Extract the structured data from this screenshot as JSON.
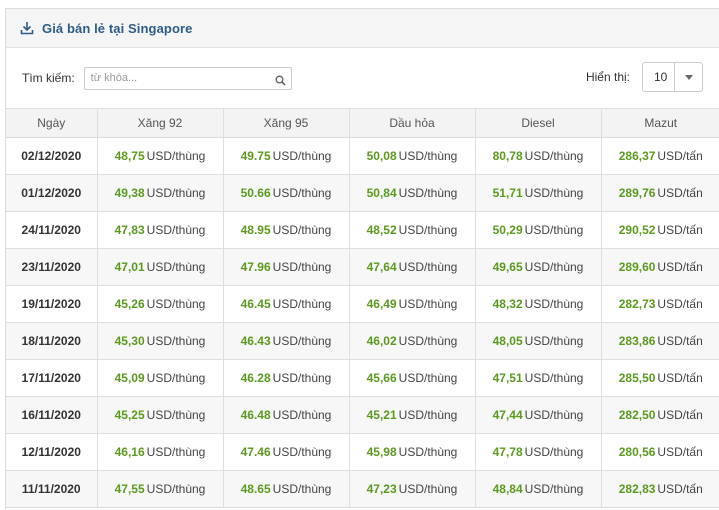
{
  "panel": {
    "title": "Giá bán lẻ tại Singapore"
  },
  "toolbar": {
    "search_label": "Tìm kiếm:",
    "search_placeholder": "từ khóa...",
    "search_value": "",
    "show_label": "Hiển thị:",
    "page_size": "10"
  },
  "table": {
    "columns": [
      "Ngày",
      "Xăng 92",
      "Xăng 95",
      "Dầu hỏa",
      "Diesel",
      "Mazut"
    ],
    "rows": [
      {
        "date": "02/12/2020",
        "x92": "48,75",
        "x92_unit": "USD/thùng",
        "x95": "49.75",
        "x95_unit": "USD/thùng",
        "dh": "50,08",
        "dh_unit": "USD/thùng",
        "diesel": "80,78",
        "diesel_unit": "USD/thùng",
        "mazut": "286,37",
        "mazut_unit": "USD/tấn"
      },
      {
        "date": "01/12/2020",
        "x92": "49,38",
        "x92_unit": "USD/thùng",
        "x95": "50.66",
        "x95_unit": "USD/thùng",
        "dh": "50,84",
        "dh_unit": "USD/thùng",
        "diesel": "51,71",
        "diesel_unit": "USD/thùng",
        "mazut": "289,76",
        "mazut_unit": "USD/tấn"
      },
      {
        "date": "24/11/2020",
        "x92": "47,83",
        "x92_unit": "USD/thùng",
        "x95": "48.95",
        "x95_unit": "USD/thùng",
        "dh": "48,52",
        "dh_unit": "USD/thùng",
        "diesel": "50,29",
        "diesel_unit": "USD/thùng",
        "mazut": "290,52",
        "mazut_unit": "USD/tấn"
      },
      {
        "date": "23/11/2020",
        "x92": "47,01",
        "x92_unit": "USD/thùng",
        "x95": "47.96",
        "x95_unit": "USD/thùng",
        "dh": "47,64",
        "dh_unit": "USD/thùng",
        "diesel": "49,65",
        "diesel_unit": "USD/thùng",
        "mazut": "289,60",
        "mazut_unit": "USD/tấn"
      },
      {
        "date": "19/11/2020",
        "x92": "45,26",
        "x92_unit": "USD/thùng",
        "x95": "46.45",
        "x95_unit": "USD/thùng",
        "dh": "46,49",
        "dh_unit": "USD/thùng",
        "diesel": "48,32",
        "diesel_unit": "USD/thùng",
        "mazut": "282,73",
        "mazut_unit": "USD/tấn"
      },
      {
        "date": "18/11/2020",
        "x92": "45,30",
        "x92_unit": "USD/thùng",
        "x95": "46.43",
        "x95_unit": "USD/thùng",
        "dh": "46,02",
        "dh_unit": "USD/thùng",
        "diesel": "48,05",
        "diesel_unit": "USD/thùng",
        "mazut": "283,86",
        "mazut_unit": "USD/tấn"
      },
      {
        "date": "17/11/2020",
        "x92": "45,09",
        "x92_unit": "USD/thùng",
        "x95": "46.28",
        "x95_unit": "USD/thùng",
        "dh": "45,66",
        "dh_unit": "USD/thùng",
        "diesel": "47,51",
        "diesel_unit": "USD/thùng",
        "mazut": "285,50",
        "mazut_unit": "USD/tấn"
      },
      {
        "date": "16/11/2020",
        "x92": "45,25",
        "x92_unit": "USD/thùng",
        "x95": "46.48",
        "x95_unit": "USD/thùng",
        "dh": "45,21",
        "dh_unit": "USD/thùng",
        "diesel": "47,44",
        "diesel_unit": "USD/thùng",
        "mazut": "282,50",
        "mazut_unit": "USD/tấn"
      },
      {
        "date": "12/11/2020",
        "x92": "46,16",
        "x92_unit": "USD/thùng",
        "x95": "47.46",
        "x95_unit": "USD/thùng",
        "dh": "45,98",
        "dh_unit": "USD/thùng",
        "diesel": "47,78",
        "diesel_unit": "USD/thùng",
        "mazut": "280,56",
        "mazut_unit": "USD/tấn"
      },
      {
        "date": "11/11/2020",
        "x92": "47,55",
        "x92_unit": "USD/thùng",
        "x95": "48.65",
        "x95_unit": "USD/thùng",
        "dh": "47,23",
        "dh_unit": "USD/thùng",
        "diesel": "48,84",
        "diesel_unit": "USD/thùng",
        "mazut": "282,83",
        "mazut_unit": "USD/tấn"
      }
    ]
  },
  "colors": {
    "value_green": "#5b9a1f",
    "title_blue": "#2e5c8a"
  },
  "icons": {
    "header": "download-icon",
    "search": "search-icon",
    "select": "chevron-down-icon"
  }
}
